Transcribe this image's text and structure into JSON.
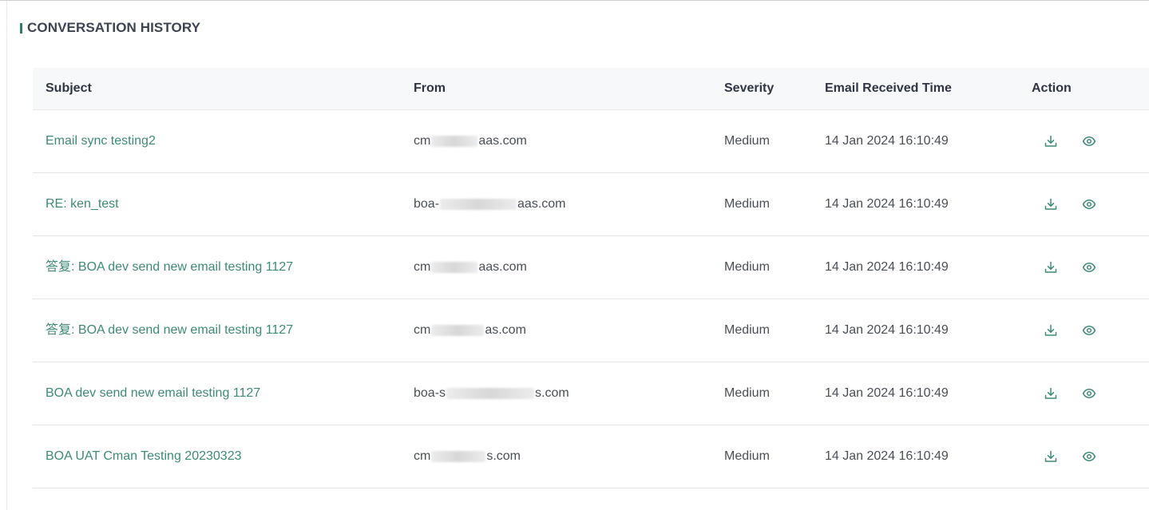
{
  "section": {
    "title": "CONVERSATION HISTORY"
  },
  "table": {
    "columns": {
      "subject": "Subject",
      "from": "From",
      "severity": "Severity",
      "time": "Email Received Time",
      "action": "Action"
    },
    "rows": [
      {
        "subject": "Email sync testing2",
        "from_prefix": "cm",
        "from_suffix": "aas.com",
        "severity": "Medium",
        "time": "14 Jan 2024 16:10:49"
      },
      {
        "subject": "RE: ken_test",
        "from_prefix": "boa-",
        "from_suffix": "aas.com",
        "severity": "Medium",
        "time": "14 Jan 2024 16:10:49"
      },
      {
        "subject": "答复: BOA dev send new email testing 1127",
        "from_prefix": "cm",
        "from_suffix": "aas.com",
        "severity": "Medium",
        "time": "14 Jan 2024 16:10:49"
      },
      {
        "subject": "答复: BOA dev send new email testing 1127",
        "from_prefix": "cm",
        "from_suffix": "as.com",
        "severity": "Medium",
        "time": "14 Jan 2024 16:10:49"
      },
      {
        "subject": "BOA dev send new email testing 1127",
        "from_prefix": "boa-s",
        "from_suffix": "s.com",
        "severity": "Medium",
        "time": "14 Jan 2024 16:10:49"
      },
      {
        "subject": "BOA UAT Cman Testing 20230323",
        "from_prefix": "cm",
        "from_suffix": "s.com",
        "severity": "Medium",
        "time": "14 Jan 2024 16:10:49"
      }
    ]
  },
  "icons": {
    "download": "download-icon",
    "view": "eye-icon"
  },
  "colors": {
    "accent": "#3e8a79",
    "title_bar": "#2f7d6b",
    "header_bg": "#f7f8fa"
  }
}
